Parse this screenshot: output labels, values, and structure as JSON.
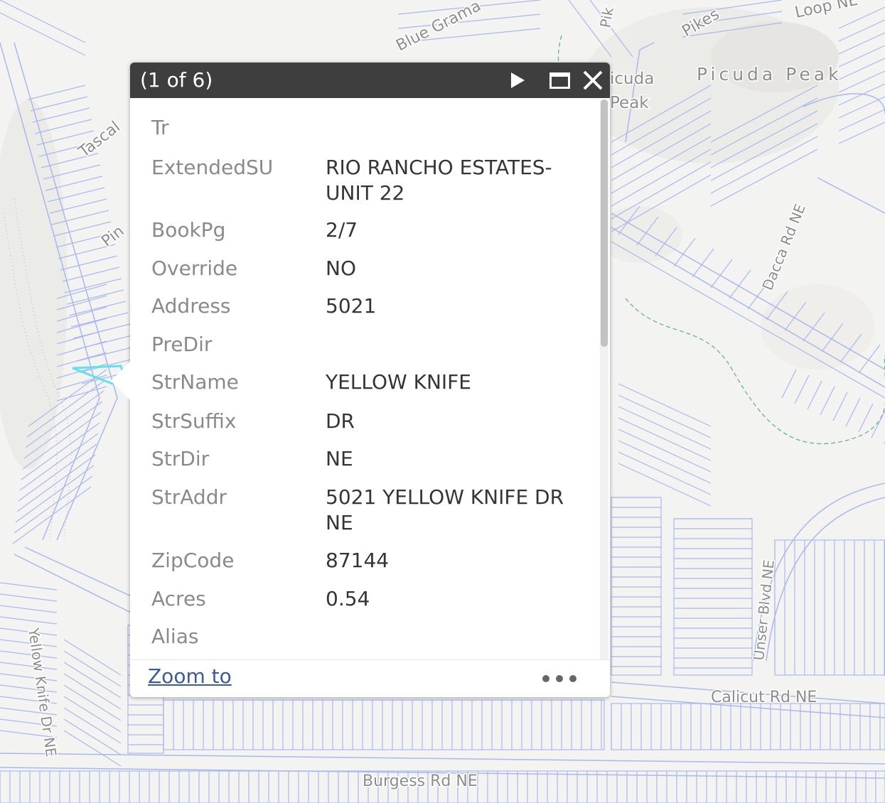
{
  "map": {
    "colors": {
      "background": "#f3f3f1",
      "parcel_line": "#a9b8ee",
      "selected_parcel": "#5ee2ee",
      "trail": "#6fb5a5"
    },
    "street_labels": [
      "Blue Grama",
      "Pikes",
      "Loop NE",
      "Picuda Peak",
      "icuda",
      "Peak",
      "Tascal",
      "Pin",
      "Dacca Rd NE",
      "Unser Blvd NE",
      "Calicut Rd NE",
      "Burgess Rd NE",
      "Yellow Knife Dr NE",
      "Pik"
    ]
  },
  "popup": {
    "title": "(1 of 6)",
    "icons": {
      "next": "play-triangle-icon",
      "maximize": "maximize-icon",
      "close": "close-x-icon",
      "more": "ellipsis-icon"
    },
    "attributes": [
      {
        "label": "Tr",
        "value": ""
      },
      {
        "label": "ExtendedSU",
        "value": "RIO RANCHO ESTATES-UNIT 22"
      },
      {
        "label": "BookPg",
        "value": "2/7"
      },
      {
        "label": "Override",
        "value": "NO"
      },
      {
        "label": "Address",
        "value": "5021"
      },
      {
        "label": "PreDir",
        "value": ""
      },
      {
        "label": "StrName",
        "value": "YELLOW KNIFE"
      },
      {
        "label": "StrSuffix",
        "value": "DR"
      },
      {
        "label": "StrDir",
        "value": "NE"
      },
      {
        "label": "StrAddr",
        "value": "5021 YELLOW KNIFE DR NE"
      },
      {
        "label": "ZipCode",
        "value": "87144"
      },
      {
        "label": "Acres",
        "value": "0.54"
      },
      {
        "label": "Alias",
        "value": ""
      }
    ],
    "footer": {
      "zoom_label": "Zoom to"
    }
  }
}
